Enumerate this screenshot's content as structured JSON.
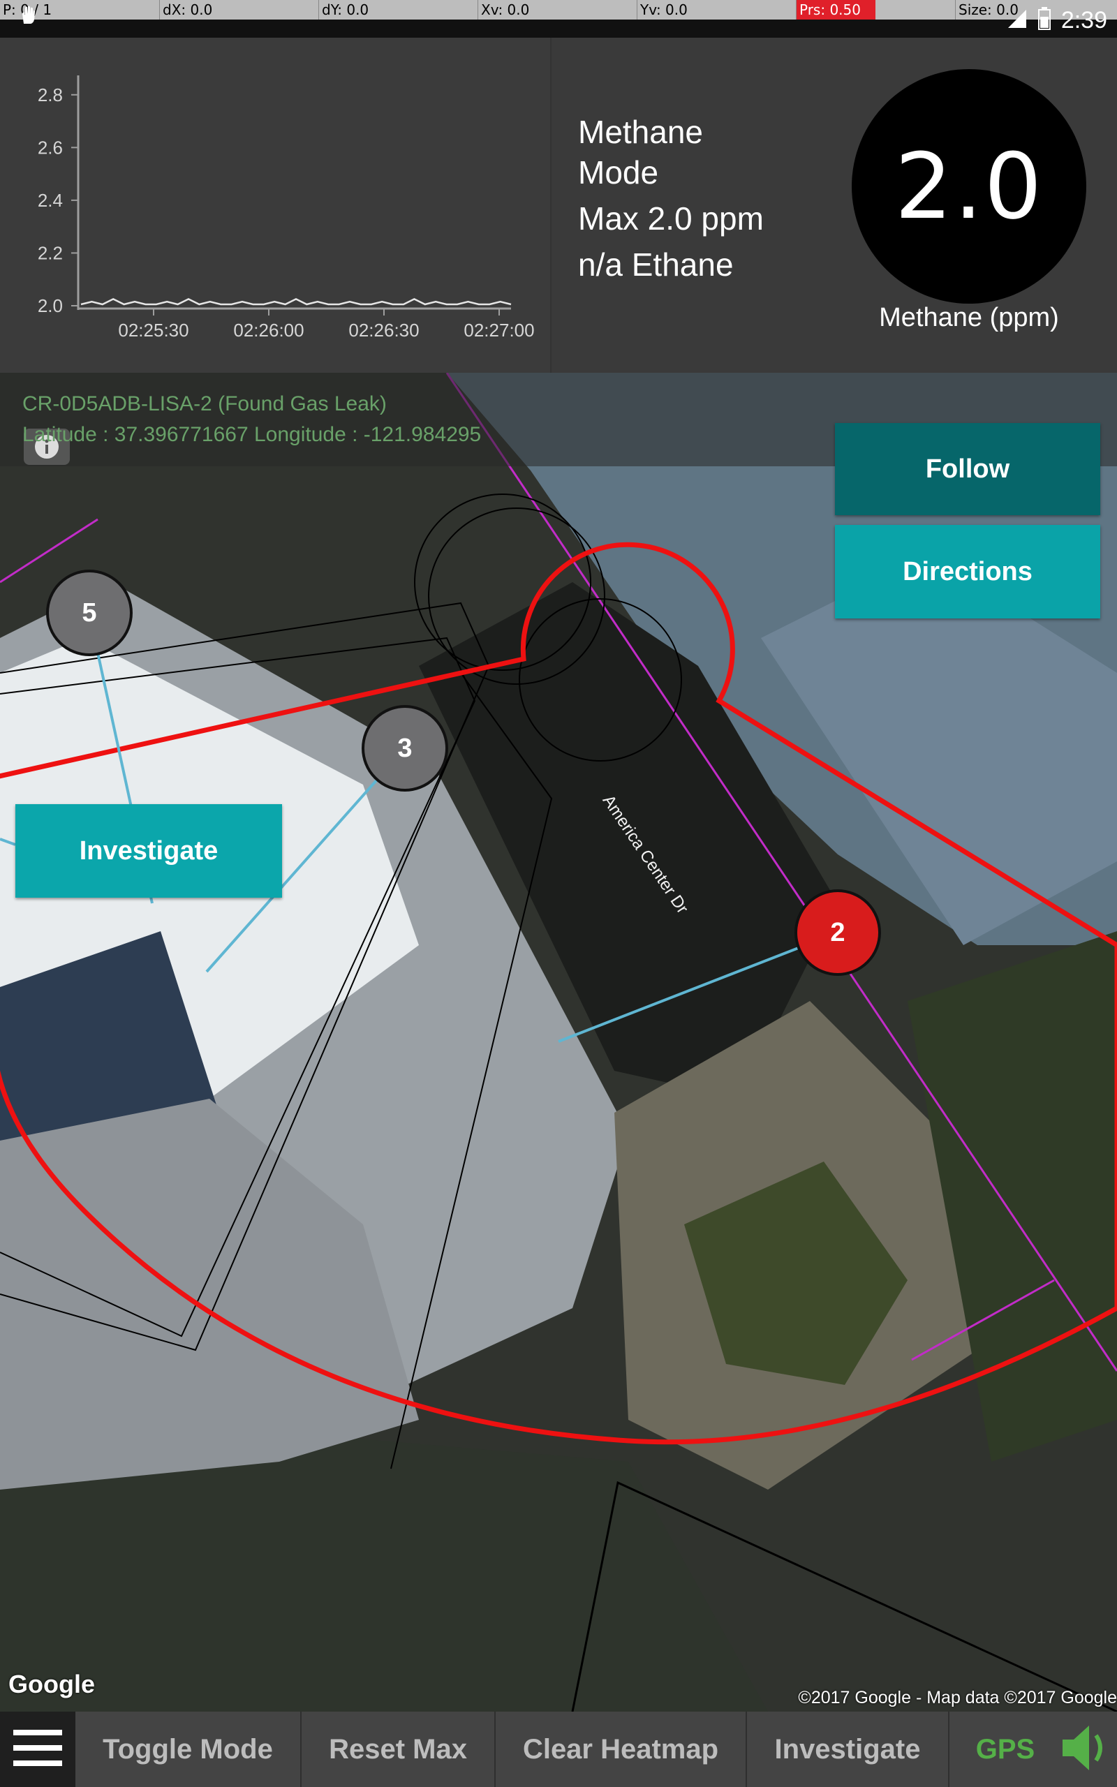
{
  "debug_bar": {
    "p": "P: 0 / 1",
    "dx": "dX: 0.0",
    "dy": "dY: 0.0",
    "xv": "Xv: 0.0",
    "yv": "Yv: 0.0",
    "prs": "Prs: 0.50",
    "size": "Size: 0.0",
    "time": "2:39"
  },
  "chart_data": {
    "type": "line",
    "title": "",
    "xlabel": "",
    "ylabel": "",
    "y_ticks": [
      "2.0",
      "2.2",
      "2.4",
      "2.6",
      "2.8"
    ],
    "x_ticks": [
      "02:25:30",
      "02:26:00",
      "02:26:30",
      "02:27:00"
    ],
    "ylim": [
      2.0,
      2.9
    ],
    "series": [
      {
        "values": [
          2.0,
          2.01,
          2.0,
          2.02,
          2.0,
          2.01,
          2.0,
          2.0,
          2.01,
          2.0,
          2.02,
          2.0,
          2.01,
          2.0,
          2.0,
          2.01,
          2.0,
          2.0,
          2.01,
          2.0,
          2.02,
          2.0,
          2.01,
          2.0,
          2.0,
          2.01,
          2.0,
          2.0,
          2.01,
          2.0,
          2.0,
          2.02,
          2.0,
          2.01,
          2.0,
          2.0,
          2.01,
          2.0,
          2.0,
          2.01,
          2.0
        ]
      }
    ],
    "colors": {
      "line": "#e6e6e6",
      "axis": "#9e9e9e",
      "tick_text": "#d6d6d6"
    }
  },
  "readout": {
    "mode_line1": "Methane",
    "mode_line2": "Mode",
    "max_line": "Max 2.0 ppm",
    "ethane_line": "n/a Ethane",
    "gauge_value": "2.0",
    "gauge_label": "Methane (ppm)"
  },
  "map": {
    "info_title": "CR-0D5ADB-LISA-2  (Found Gas Leak)",
    "info_coords": "Latitude : 37.396771667  Longitude  :  -121.984295",
    "info_icon": "info-icon",
    "follow_label": "Follow",
    "directions_label": "Directions",
    "investigate_label": "Investigate",
    "street_label": "America Center Dr",
    "markers": [
      "5",
      "3",
      "2"
    ],
    "google_logo": "Google",
    "credit": "©2017 Google - Map data ©2017 Google",
    "colors": {
      "plume": "#ee1111",
      "road_line": "#c22cc8",
      "follow_btn": "#06666a",
      "directions_btn": "#0aa3a8"
    }
  },
  "toolbar": {
    "menu_icon": "hamburger-icon",
    "toggle_mode": "Toggle Mode",
    "reset_max": "Reset Max",
    "clear_heatmap": "Clear Heatmap",
    "investigate": "Investigate",
    "gps": "GPS",
    "sound_icon": "speaker-icon"
  }
}
